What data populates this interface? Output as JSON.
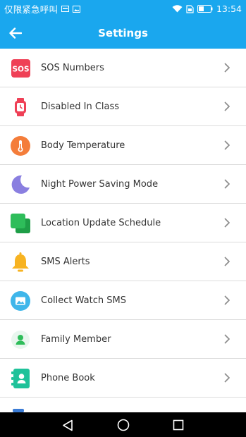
{
  "status_bar": {
    "carrier": "仅限紧急呼叫",
    "time": "13:54"
  },
  "header": {
    "title": "Settings",
    "back_icon": "arrow-left-icon"
  },
  "menu": [
    {
      "label": "SOS Numbers",
      "icon": "sos-icon",
      "icon_text": "SOS",
      "color": "#ef4056"
    },
    {
      "label": "Disabled In Class",
      "icon": "watch-icon",
      "color": "#ef4056"
    },
    {
      "label": "Body Temperature",
      "icon": "thermometer-icon",
      "color": "#f47d3a"
    },
    {
      "label": "Night Power Saving Mode",
      "icon": "moon-icon",
      "color": "#8a7fe0"
    },
    {
      "label": "Location Update Schedule",
      "icon": "stacked-squares-icon",
      "color": "#2ebd5a"
    },
    {
      "label": "SMS Alerts",
      "icon": "bell-icon",
      "color": "#f7b321"
    },
    {
      "label": "Collect Watch SMS",
      "icon": "image-message-icon",
      "color": "#3fb6ea"
    },
    {
      "label": "Family Member",
      "icon": "person-icon",
      "color": "#2ebd5a"
    },
    {
      "label": "Phone Book",
      "icon": "contact-book-icon",
      "color": "#1fc29a"
    }
  ],
  "nav": {
    "back": "triangle-back-icon",
    "home": "circle-home-icon",
    "recents": "square-recents-icon"
  }
}
